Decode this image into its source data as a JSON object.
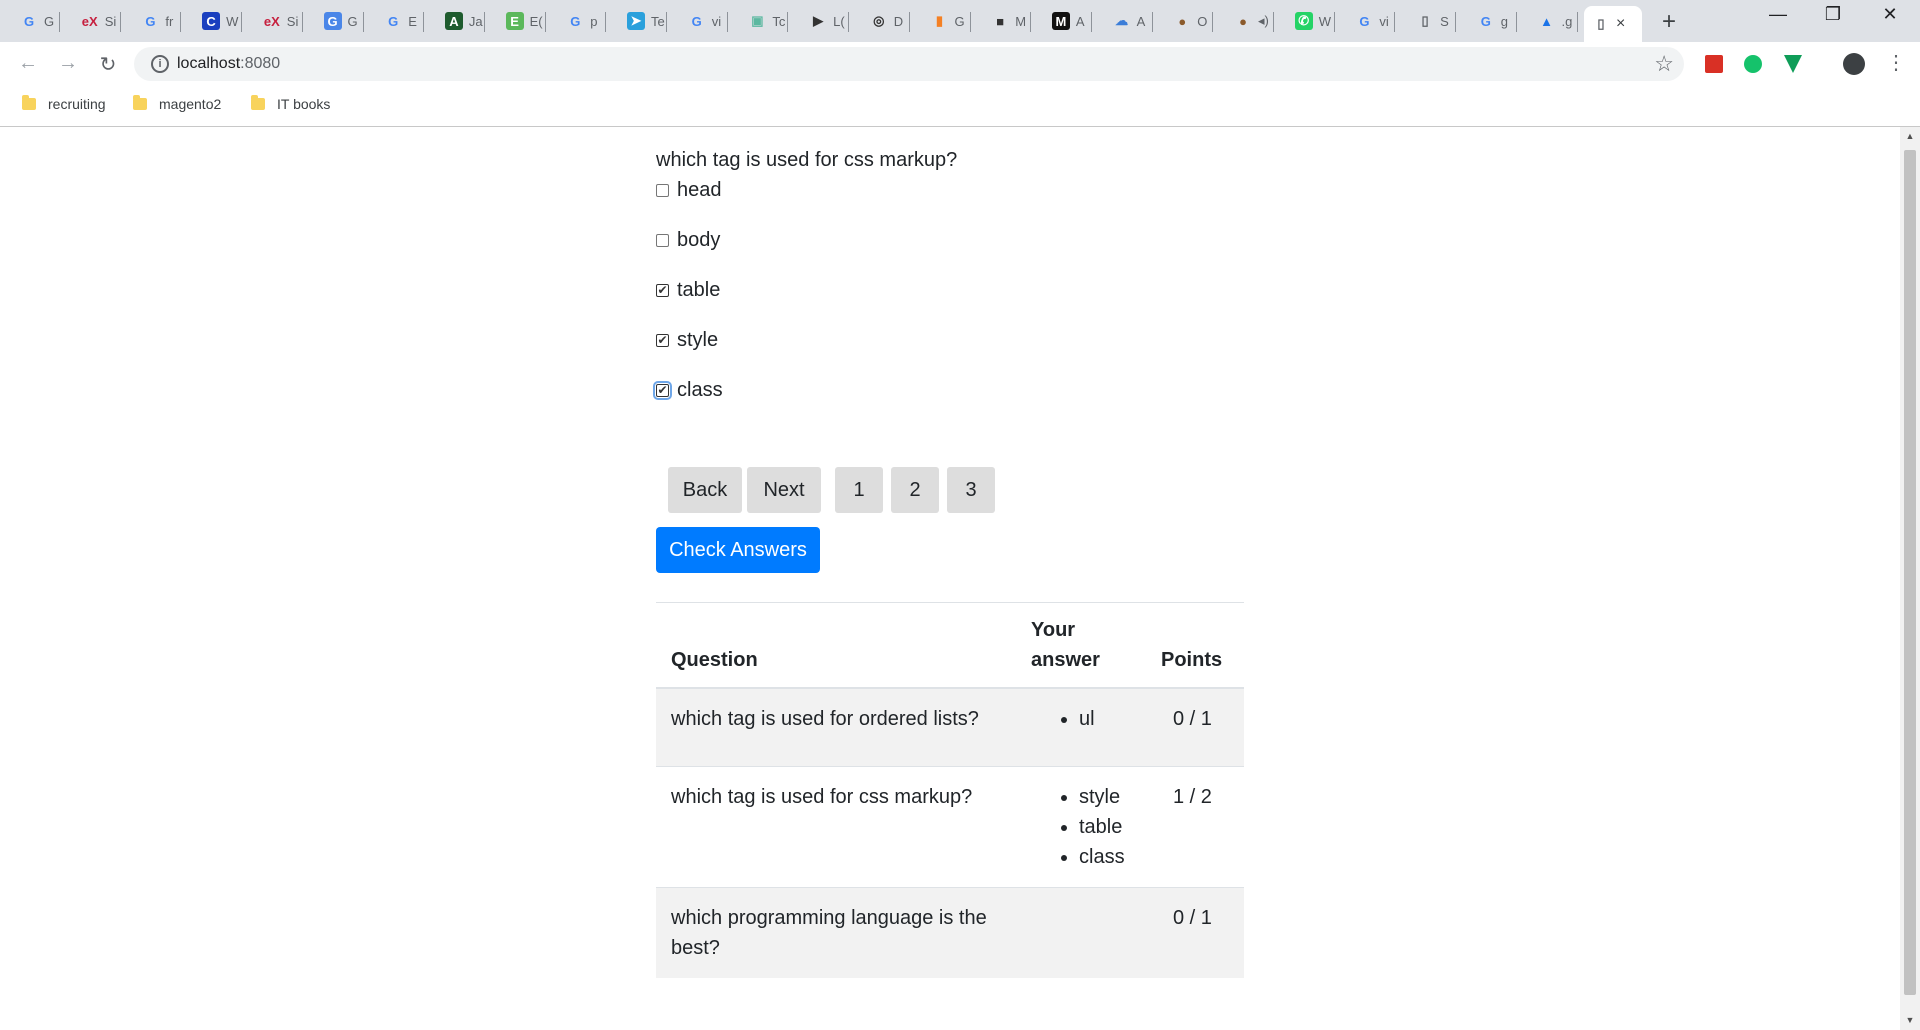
{
  "browser": {
    "tabs": [
      {
        "favicon": "G",
        "color": "#4285f4",
        "bg": "transparent",
        "label": "G"
      },
      {
        "favicon": "eX",
        "color": "#c6203f",
        "bg": "transparent",
        "label": "Si"
      },
      {
        "favicon": "G",
        "color": "#4285f4",
        "bg": "transparent",
        "label": "fr"
      },
      {
        "favicon": "C",
        "color": "#ffffff",
        "bg": "#1a3fbf",
        "label": "W"
      },
      {
        "favicon": "eX",
        "color": "#c6203f",
        "bg": "transparent",
        "label": "Si"
      },
      {
        "favicon": "G",
        "color": "#ffffff",
        "bg": "#4a86e8",
        "label": "G"
      },
      {
        "favicon": "G",
        "color": "#4285f4",
        "bg": "transparent",
        "label": "E"
      },
      {
        "favicon": "A",
        "color": "#ffffff",
        "bg": "#1e5b2e",
        "label": "Ja"
      },
      {
        "favicon": "E",
        "color": "#ffffff",
        "bg": "#5bb85b",
        "label": "E("
      },
      {
        "favicon": "G",
        "color": "#4285f4",
        "bg": "transparent",
        "label": "p"
      },
      {
        "favicon": "➤",
        "color": "#ffffff",
        "bg": "#2aa0dc",
        "label": "Te"
      },
      {
        "favicon": "G",
        "color": "#4285f4",
        "bg": "transparent",
        "label": "vi"
      },
      {
        "favicon": "▣",
        "color": "#5bb8a0",
        "bg": "transparent",
        "label": "Tc"
      },
      {
        "favicon": "▶",
        "color": "#333333",
        "bg": "transparent",
        "label": "L("
      },
      {
        "favicon": "◎",
        "color": "#333333",
        "bg": "transparent",
        "label": "D"
      },
      {
        "favicon": "▮",
        "color": "#f48024",
        "bg": "transparent",
        "label": "G"
      },
      {
        "favicon": "■",
        "color": "#333333",
        "bg": "transparent",
        "label": "M"
      },
      {
        "favicon": "M",
        "color": "#ffffff",
        "bg": "#111111",
        "label": "A"
      },
      {
        "favicon": "☁",
        "color": "#3b7dd8",
        "bg": "transparent",
        "label": "A"
      },
      {
        "favicon": "●",
        "color": "#8b5a2b",
        "bg": "transparent",
        "label": "O"
      },
      {
        "favicon": "●",
        "color": "#8b5a2b",
        "bg": "transparent",
        "label": "◂)"
      },
      {
        "favicon": "✆",
        "color": "#ffffff",
        "bg": "#25d366",
        "label": "W"
      },
      {
        "favicon": "G",
        "color": "#4285f4",
        "bg": "transparent",
        "label": "vi"
      },
      {
        "favicon": "▯",
        "color": "#5f6368",
        "bg": "transparent",
        "label": "S"
      },
      {
        "favicon": "G",
        "color": "#4285f4",
        "bg": "transparent",
        "label": "g"
      },
      {
        "favicon": "▲",
        "color": "#1a73e8",
        "bg": "transparent",
        "label": ".g"
      }
    ],
    "active_tab_icon": "▯",
    "new_tab": "+",
    "window_controls": {
      "minimize": "—",
      "restore": "❐",
      "close": "✕"
    },
    "nav": {
      "back": "←",
      "forward": "→",
      "reload": "↻"
    },
    "url_host": "localhost",
    "url_port": ":8080",
    "bookmarks": [
      "recruiting",
      "magento2",
      "IT books"
    ],
    "extension_colors": [
      "#d93025",
      "#15c26b",
      "#0f9d58",
      "#3c4043"
    ]
  },
  "quiz": {
    "question": "which tag is used for css markup?",
    "options": [
      {
        "label": "head",
        "checked": false
      },
      {
        "label": "body",
        "checked": false
      },
      {
        "label": "table",
        "checked": true
      },
      {
        "label": "style",
        "checked": true
      },
      {
        "label": "class",
        "checked": true
      }
    ],
    "buttons": {
      "back": "Back",
      "next": "Next",
      "pages": [
        "1",
        "2",
        "3"
      ],
      "check": "Check Answers"
    }
  },
  "results": {
    "headers": {
      "question": "Question",
      "answer_line1": "Your",
      "answer_line2": "answer",
      "points": "Points"
    },
    "rows": [
      {
        "question": "which tag is used for ordered lists?",
        "answers": [
          "ul"
        ],
        "points": "0 / 1"
      },
      {
        "question": "which tag is used for css markup?",
        "answers": [
          "style",
          "table",
          "class"
        ],
        "points": "1 / 2"
      },
      {
        "question": "which programming language is the best?",
        "answers": [],
        "points": "0 / 1"
      }
    ]
  }
}
